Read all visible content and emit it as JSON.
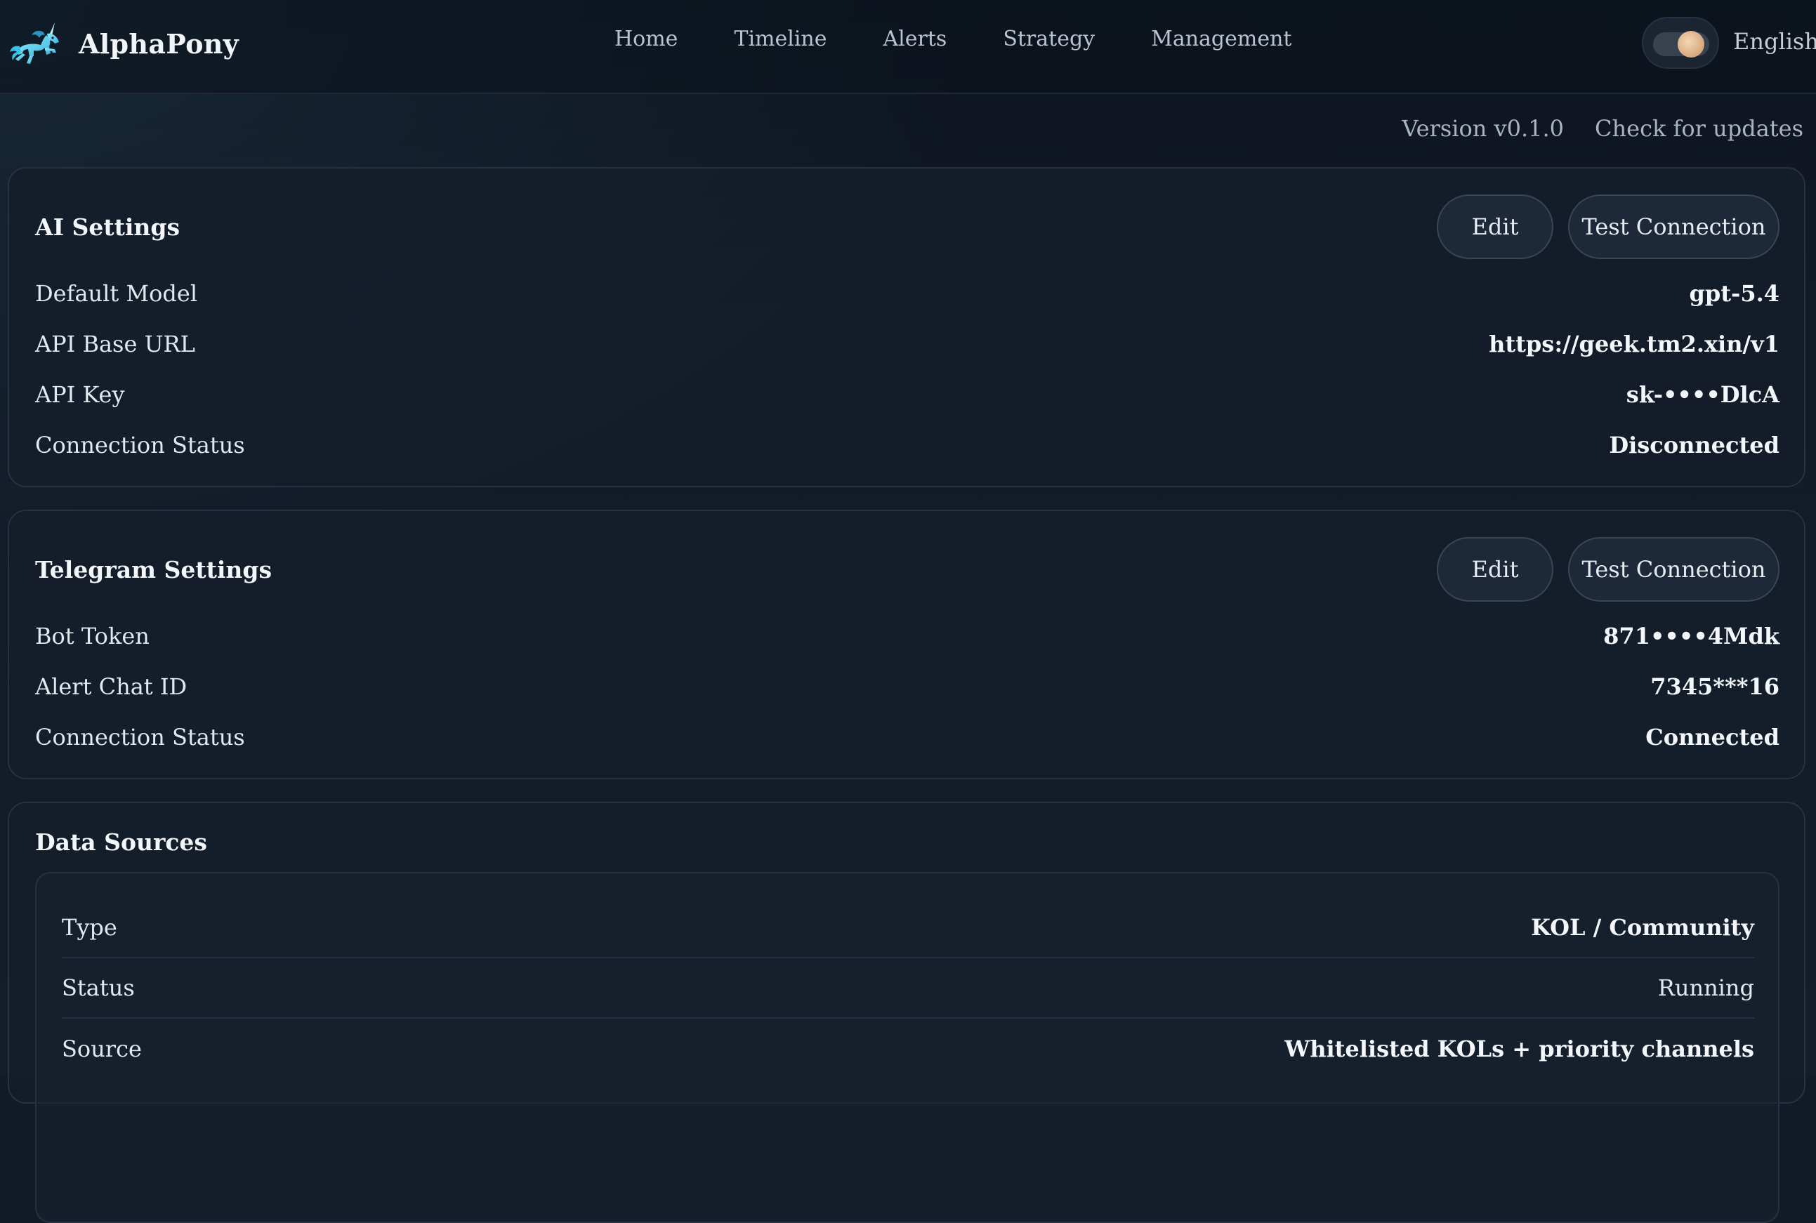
{
  "app": {
    "name": "AlphaPony",
    "logo_icon": "unicorn-logo-icon"
  },
  "nav": {
    "items": [
      {
        "label": "Home"
      },
      {
        "label": "Timeline"
      },
      {
        "label": "Alerts"
      },
      {
        "label": "Strategy"
      },
      {
        "label": "Management"
      }
    ],
    "language": "English",
    "theme_toggle_icon": "theme-toggle-icon"
  },
  "version_bar": {
    "version": "Version v0.1.0",
    "check_updates": "Check for updates"
  },
  "ai_settings": {
    "title": "AI Settings",
    "edit_label": "Edit",
    "test_label": "Test Connection",
    "rows": [
      {
        "label": "Default Model",
        "value": "gpt-5.4"
      },
      {
        "label": "API Base URL",
        "value": "https://geek.tm2.xin/v1"
      },
      {
        "label": "API Key",
        "value": "sk-••••DlcA"
      },
      {
        "label": "Connection Status",
        "value": "Disconnected"
      }
    ]
  },
  "telegram_settings": {
    "title": "Telegram Settings",
    "edit_label": "Edit",
    "test_label": "Test Connection",
    "rows": [
      {
        "label": "Bot Token",
        "value": "871••••4Mdk"
      },
      {
        "label": "Alert Chat ID",
        "value": "7345***16"
      },
      {
        "label": "Connection Status",
        "value": "Connected"
      }
    ]
  },
  "data_sources": {
    "title": "Data Sources",
    "rows": [
      {
        "label": "Type",
        "value": "KOL / Community"
      },
      {
        "label": "Status",
        "value": "Running"
      },
      {
        "label": "Source",
        "value": "Whitelisted KOLs + priority channels"
      }
    ]
  },
  "colors": {
    "background": "#121a27",
    "card": "#151d2a",
    "border": "#273142",
    "accent_logo": "#5fd6f2",
    "text": "#e9edf3",
    "muted": "#aab3c0"
  }
}
